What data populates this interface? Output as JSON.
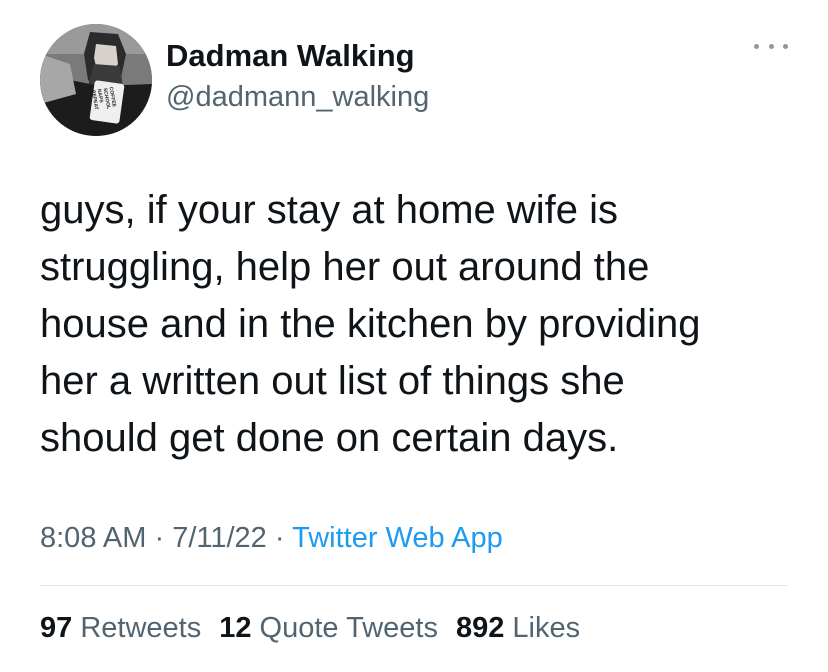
{
  "author": {
    "display_name": "Dadman Walking",
    "handle": "@dadmann_walking"
  },
  "tweet": {
    "lines": [
      "guys, if your stay at home wife is",
      "struggling, help her out around the",
      "house and in the kitchen by providing",
      "her a written out list of things she",
      "should get done on certain days."
    ],
    "time": "8:08 AM",
    "date": "7/11/22",
    "separator": "·",
    "source": "Twitter Web App"
  },
  "stats": {
    "retweets_count": "97",
    "retweets_label": "Retweets",
    "quotes_count": "12",
    "quotes_label": "Quote Tweets",
    "likes_count": "892",
    "likes_label": "Likes"
  },
  "avatar": {
    "mug_text": [
      "COFFEE",
      "SCHOOL",
      "NAPS",
      "REPEAT"
    ]
  },
  "colors": {
    "text": "#0f1419",
    "secondary": "#536471",
    "link": "#1d9bf0",
    "divider": "#e1e8ed"
  },
  "icons": {
    "more": "more-horizontal-icon"
  }
}
